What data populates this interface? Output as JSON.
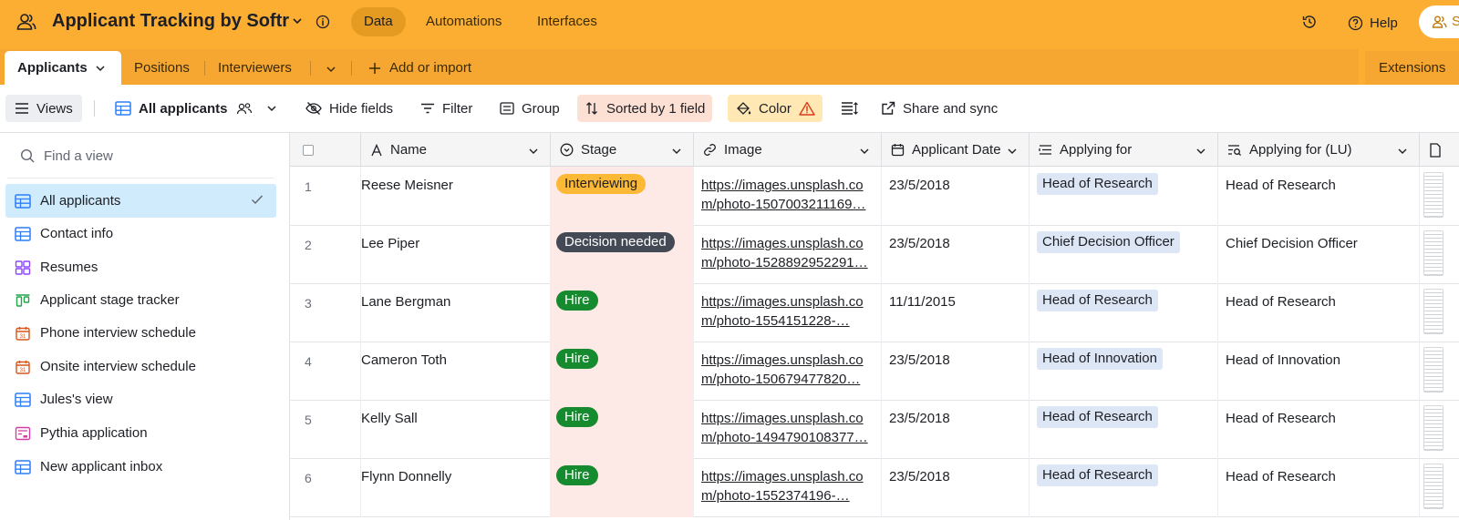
{
  "app": {
    "title": "Applicant Tracking by Softr",
    "nav": [
      "Data",
      "Automations",
      "Interfaces"
    ],
    "help_label": "Help",
    "share_label": "S"
  },
  "tables": {
    "active": "Applicants",
    "others": [
      "Positions",
      "Interviewers"
    ],
    "add_import_label": "Add or import",
    "extensions_label": "Extensions"
  },
  "toolbar": {
    "views_label": "Views",
    "current_view": "All applicants",
    "hide_fields": "Hide fields",
    "filter": "Filter",
    "group": "Group",
    "sorted": "Sorted by 1 field",
    "color": "Color",
    "share_sync": "Share and sync"
  },
  "sidebar": {
    "find_placeholder": "Find a view",
    "views": [
      {
        "label": "All applicants",
        "icon": "grid-icon",
        "active": true
      },
      {
        "label": "Contact info",
        "icon": "grid-icon"
      },
      {
        "label": "Resumes",
        "icon": "gallery-icon"
      },
      {
        "label": "Applicant stage tracker",
        "icon": "kanban-icon"
      },
      {
        "label": "Phone interview schedule",
        "icon": "calendar-icon"
      },
      {
        "label": "Onsite interview schedule",
        "icon": "calendar-icon"
      },
      {
        "label": "Jules's view",
        "icon": "grid-icon"
      },
      {
        "label": "Pythia application",
        "icon": "form-icon"
      },
      {
        "label": "New applicant inbox",
        "icon": "grid-icon"
      }
    ]
  },
  "grid": {
    "columns": [
      "Name",
      "Stage",
      "Image",
      "Applicant Date",
      "Applying for",
      "Applying for (LU)"
    ],
    "rows": [
      {
        "num": "1",
        "name": "Reese Meisner",
        "stage": "Interviewing",
        "stage_color": "#fcb935",
        "stage_text": "#1d1f25",
        "image_1": "https://images.unsplash.co",
        "image_2": "m/photo-1507003211169…",
        "date": "23/5/2018",
        "applying": "Head of Research",
        "applying_lu": "Head of Research"
      },
      {
        "num": "2",
        "name": "Lee Piper",
        "stage": "Decision needed",
        "stage_color": "#444a55",
        "stage_text": "#ffffff",
        "image_1": "https://images.unsplash.co",
        "image_2": "m/photo-1528892952291…",
        "date": "23/5/2018",
        "applying": "Chief Decision Officer",
        "applying_lu": "Chief Decision Officer"
      },
      {
        "num": "3",
        "name": "Lane Bergman",
        "stage": "Hire",
        "stage_color": "#168a2e",
        "stage_text": "#ffffff",
        "image_1": "https://images.unsplash.co",
        "image_2": "m/photo-1554151228-…",
        "date": "11/11/2015",
        "applying": "Head of Research",
        "applying_lu": "Head of Research"
      },
      {
        "num": "4",
        "name": "Cameron Toth",
        "stage": "Hire",
        "stage_color": "#168a2e",
        "stage_text": "#ffffff",
        "image_1": "https://images.unsplash.co",
        "image_2": "m/photo-150679477820…",
        "date": "23/5/2018",
        "applying": "Head of Innovation",
        "applying_lu": "Head of Innovation"
      },
      {
        "num": "5",
        "name": "Kelly Sall",
        "stage": "Hire",
        "stage_color": "#168a2e",
        "stage_text": "#ffffff",
        "image_1": "https://images.unsplash.co",
        "image_2": "m/photo-1494790108377…",
        "date": "23/5/2018",
        "applying": "Head of Research",
        "applying_lu": "Head of Research"
      },
      {
        "num": "6",
        "name": "Flynn Donnelly",
        "stage": "Hire",
        "stage_color": "#168a2e",
        "stage_text": "#ffffff",
        "image_1": "https://images.unsplash.co",
        "image_2": "m/photo-1552374196-…",
        "date": "23/5/2018",
        "applying": "Head of Research",
        "applying_lu": "Head of Research"
      }
    ]
  },
  "colors": {
    "brand": "#fcae32",
    "active_view": "#cfebfc",
    "sorted_bg": "#fde0d4",
    "color_bg": "#ffe8b3"
  }
}
